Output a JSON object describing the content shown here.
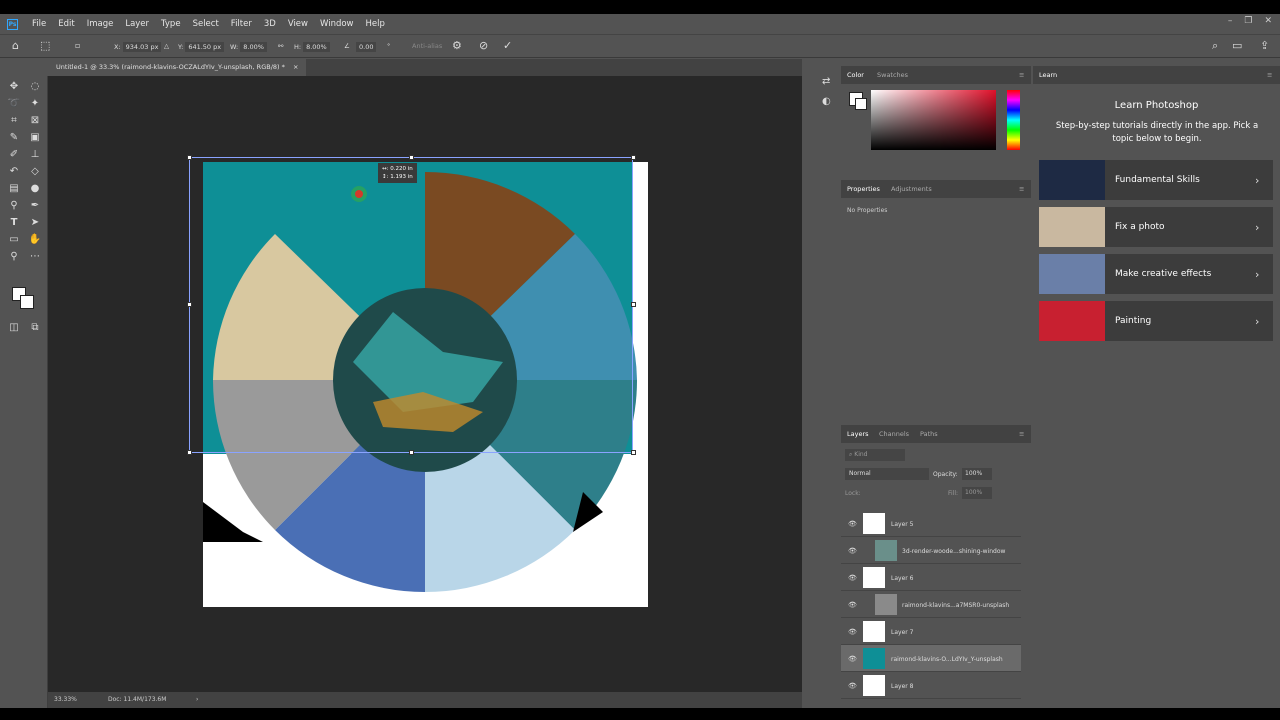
{
  "menubar": {
    "logo": "Ps",
    "items": [
      "File",
      "Edit",
      "Image",
      "Layer",
      "Type",
      "Select",
      "Filter",
      "3D",
      "View",
      "Window",
      "Help"
    ]
  },
  "options": {
    "x_label": "X:",
    "x_value": "934.03 px",
    "y_label": "Y:",
    "y_value": "641.50 px",
    "w_label": "W:",
    "w_value": "8.00%",
    "h_label": "H:",
    "h_value": "8.00%",
    "angle_value": "0.00",
    "degree": "°",
    "interp": "Anti-alias"
  },
  "doc_tab": {
    "title": "Untitled-1 @ 33.3% (raimond-klavins-OCZALdYIv_Y-unsplash, RGB/8) *",
    "close": "×"
  },
  "tooltip": {
    "line1": "↔: 0.220 in",
    "line2": "↕: 1.193 in"
  },
  "status": {
    "zoom": "33.33%",
    "doc": "Doc: 11.4M/173.6M",
    "arrow": "›"
  },
  "color_panel": {
    "tabs": [
      "Color",
      "Swatches"
    ]
  },
  "properties_panel": {
    "tabs": [
      "Properties",
      "Adjustments"
    ],
    "empty": "No Properties"
  },
  "layers_panel": {
    "tabs": [
      "Layers",
      "Channels",
      "Paths"
    ],
    "kind": "Kind",
    "blend_mode": "Normal",
    "opacity_label": "Opacity:",
    "opacity_value": "100%",
    "lock_label": "Lock:",
    "fill_label": "Fill:",
    "fill_value": "100%",
    "layers": [
      {
        "name": "Layer 5",
        "selected": false
      },
      {
        "name": "3d-render-woode...shining-window",
        "selected": false
      },
      {
        "name": "Layer 6",
        "selected": false
      },
      {
        "name": "raimond-klavins...a7MSR0-unsplash",
        "selected": false
      },
      {
        "name": "Layer 7",
        "selected": false
      },
      {
        "name": "raimond-klavins-O...LdYIv_Y-unsplash",
        "selected": true
      },
      {
        "name": "Layer 8",
        "selected": false
      }
    ]
  },
  "learn": {
    "tab": "Learn",
    "title": "Learn Photoshop",
    "subtitle": "Step-by-step tutorials directly in the app. Pick a topic below to begin.",
    "cards": [
      {
        "label": "Fundamental Skills"
      },
      {
        "label": "Fix a photo"
      },
      {
        "label": "Make creative effects"
      },
      {
        "label": "Painting"
      }
    ]
  },
  "colors": {
    "accent": "#31a8ff",
    "panel": "#535353",
    "canvas": "#282828"
  }
}
